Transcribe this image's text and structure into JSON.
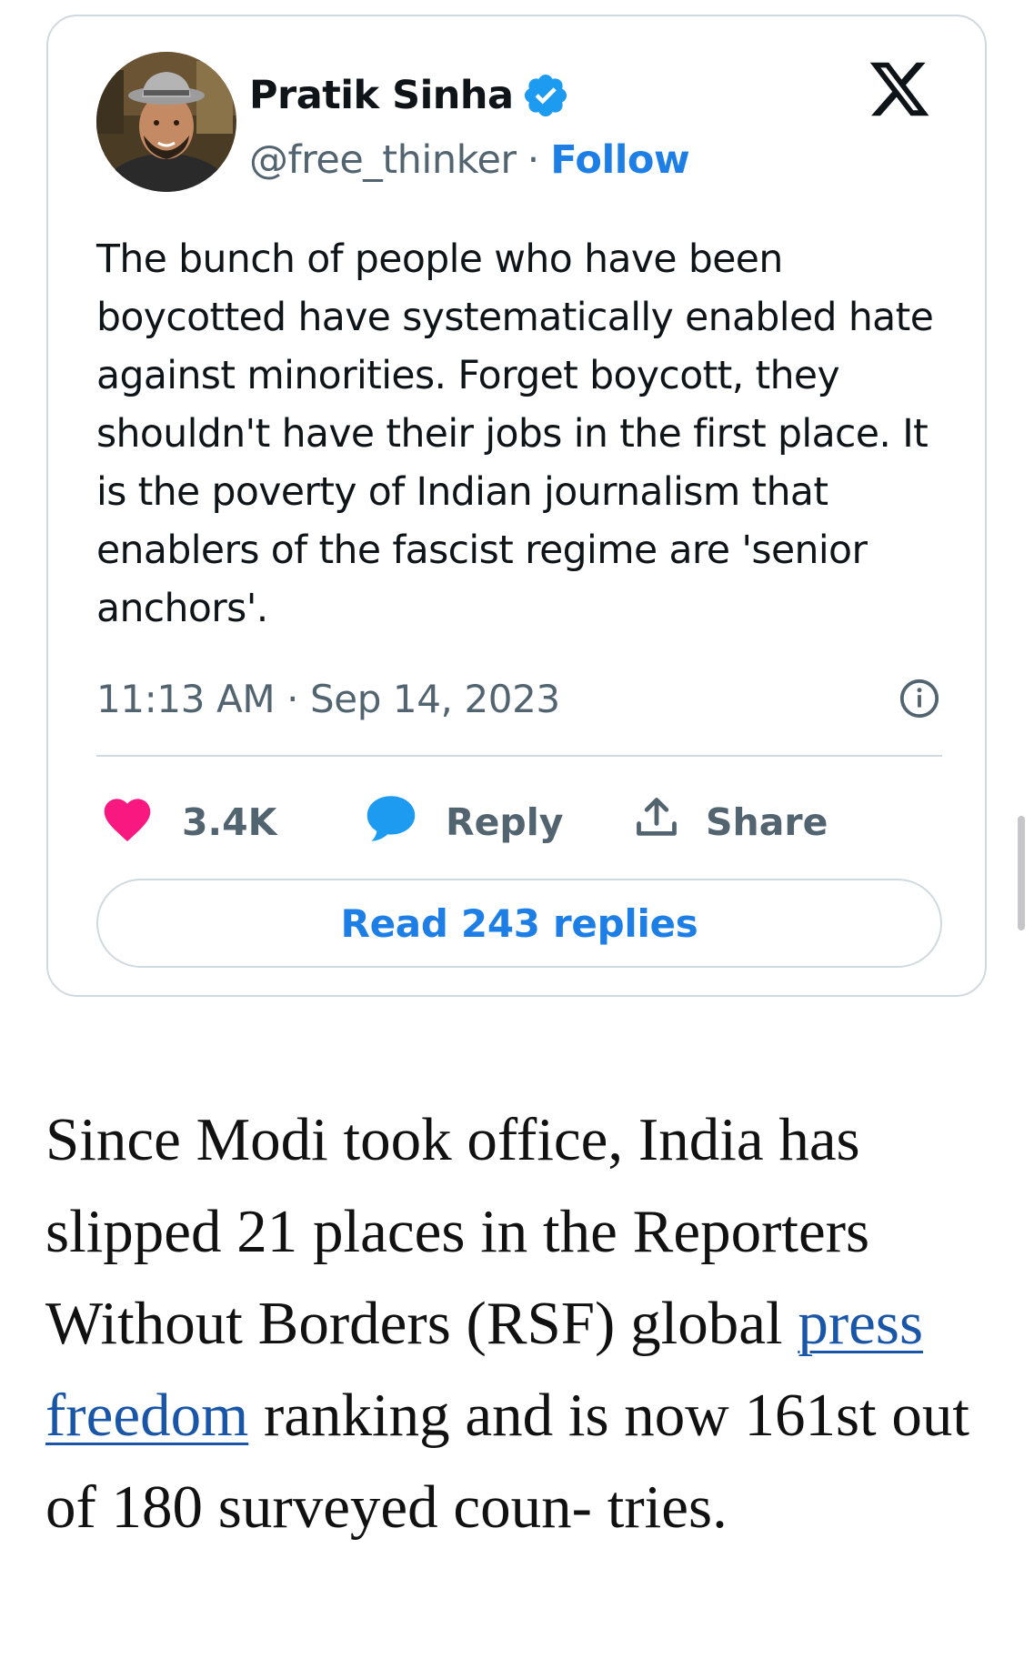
{
  "tweet": {
    "author_name": "Pratik Sinha",
    "handle": "@free_thinker",
    "separator": "·",
    "follow_label": "Follow",
    "text": "The bunch of people who have been boycotted have systematically enabled hate against minorities. Forget boycott, they shouldn't have their jobs in the first place. It is the poverty of Indian journalism that enablers of the fascist regime are 'senior anchors'.",
    "timestamp": "11:13 AM · Sep 14, 2023",
    "likes": "3.4K",
    "reply_label": "Reply",
    "share_label": "Share",
    "read_replies_label": "Read 243 replies",
    "icons": {
      "platform": "x-logo-icon",
      "verified": "verified-badge-icon",
      "info": "info-icon",
      "like": "heart-icon",
      "reply": "speech-bubble-icon",
      "share": "share-upload-icon"
    }
  },
  "article": {
    "text_before": "Since Modi took office, India has slipped 21 places in the Reporters Without Borders (RSF) global ",
    "link_text": "press freedom",
    "text_after": " ranking and is now 161st out of 180 surveyed coun- tries."
  },
  "colors": {
    "accent_blue": "#1d7fe6",
    "like_pink": "#f91880",
    "muted_text": "#536471",
    "border": "#cfd9de",
    "article_link": "#1a56a8"
  }
}
